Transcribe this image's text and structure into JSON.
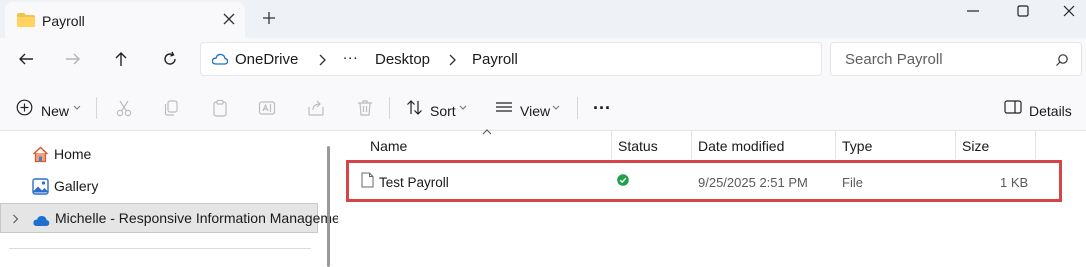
{
  "window": {
    "tab_title": "Payroll",
    "controls": {
      "minimize": "minimize-icon",
      "maximize": "maximize-icon",
      "close": "close-icon"
    }
  },
  "address_bar": {
    "breadcrumb": [
      "OneDrive",
      "...",
      "Desktop",
      "Payroll"
    ],
    "search_placeholder": "Search Payroll"
  },
  "toolbar": {
    "new_label": "New",
    "sort_label": "Sort",
    "view_label": "View",
    "more_label": "...",
    "details_label": "Details"
  },
  "sidebar": {
    "items": [
      {
        "label": "Home",
        "icon": "home-icon"
      },
      {
        "label": "Gallery",
        "icon": "gallery-icon"
      },
      {
        "label": "Michelle - Responsive Information Manageme",
        "icon": "onedrive-cloud-icon",
        "selected": true
      }
    ]
  },
  "file_list": {
    "columns": [
      "Name",
      "Status",
      "Date modified",
      "Type",
      "Size"
    ],
    "rows": [
      {
        "name": "Test Payroll",
        "status": "synced",
        "date_modified": "9/25/2025 2:51 PM",
        "type": "File",
        "size": "1 KB"
      }
    ]
  },
  "colors": {
    "titlebar_bg": "#eef1f6",
    "highlight_border": "#d64545",
    "status_ok": "#22a04b",
    "folder_yellow": "#f2c24d",
    "accent_blue": "#1f6fd1"
  }
}
